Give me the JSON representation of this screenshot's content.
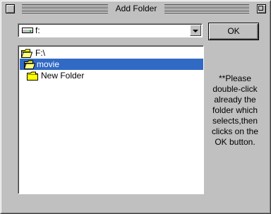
{
  "window": {
    "title": "Add Folder"
  },
  "drive": {
    "label": "f:",
    "icon": "drive-icon"
  },
  "ok_button": {
    "label": "OK"
  },
  "tree": {
    "items": [
      {
        "label": "F:\\",
        "icon": "open-folder-icon"
      },
      {
        "label": "movie",
        "icon": "open-folder-icon",
        "selected": true
      },
      {
        "label": "New Folder",
        "icon": "folder-icon"
      }
    ]
  },
  "help": {
    "lines": [
      "**Please",
      "double-click",
      "already the",
      "folder which",
      "selects,then",
      "clicks on the",
      "OK button."
    ]
  },
  "colors": {
    "selection": "#316ac5",
    "face": "#c0c0c0",
    "folder": "#ffff00"
  }
}
